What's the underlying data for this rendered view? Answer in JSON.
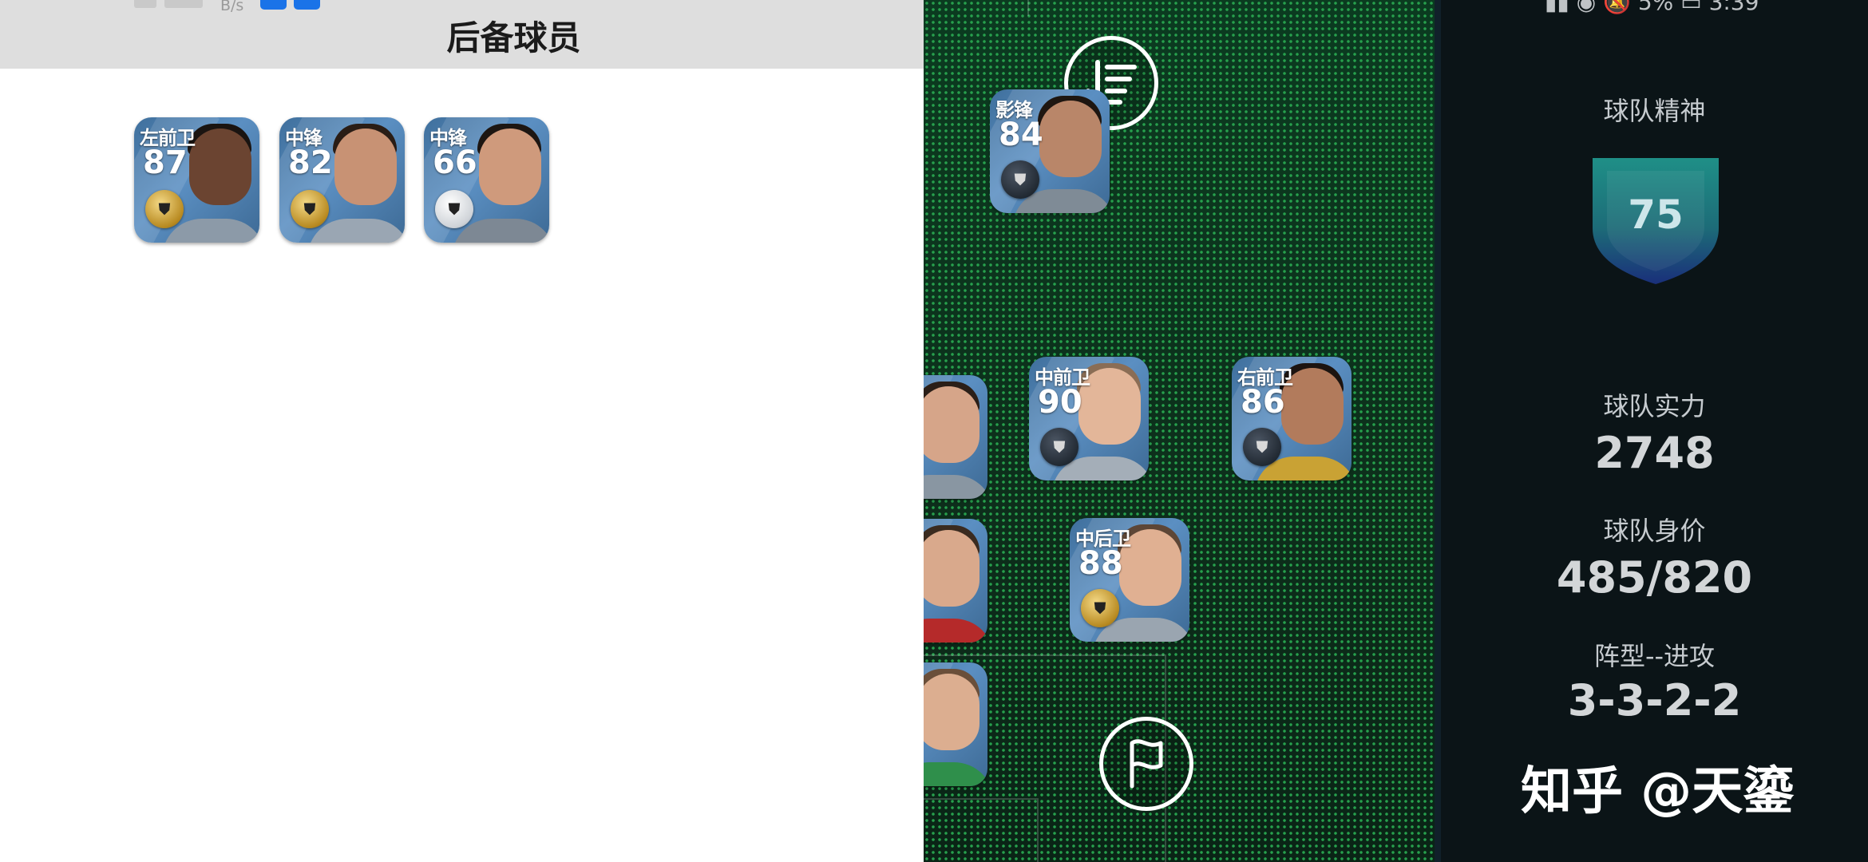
{
  "status_bar": {
    "net_speed_unit": "B/s",
    "battery_text": "5%",
    "time": "3:39"
  },
  "bench": {
    "title": "后备球员",
    "players": [
      {
        "position": "左前卫",
        "rating": "87",
        "medal": "gold"
      },
      {
        "position": "中锋",
        "rating": "82",
        "medal": "gold"
      },
      {
        "position": "中锋",
        "rating": "66",
        "medal": "silver"
      }
    ]
  },
  "pitch": {
    "players": [
      {
        "position": "影锋",
        "rating": "84",
        "medal": "dark"
      },
      {
        "position": "中前卫",
        "rating": "90",
        "medal": "dark"
      },
      {
        "position": "右前卫",
        "rating": "86",
        "medal": "dark"
      },
      {
        "position": "中后卫",
        "rating": "88",
        "medal": "gold"
      },
      {
        "position": "",
        "rating": ""
      },
      {
        "position": "",
        "rating": ""
      },
      {
        "position": "",
        "rating": ""
      }
    ],
    "sort_icon": "sort-order-icon",
    "flag_icon": "flag-icon"
  },
  "stats": {
    "team_spirit_label": "球队精神",
    "team_spirit_value": "75",
    "team_strength_label": "球队实力",
    "team_strength_value": "2748",
    "team_value_label": "球队身价",
    "team_value_value": "485/820",
    "formation_label": "阵型--进攻",
    "formation_value": "3-3-2-2"
  },
  "watermark": "知乎 @天鎏",
  "colors": {
    "shield_top": "#1f8f87",
    "shield_bottom": "#1a2f7a",
    "pitch_dots": "#27a04d"
  }
}
